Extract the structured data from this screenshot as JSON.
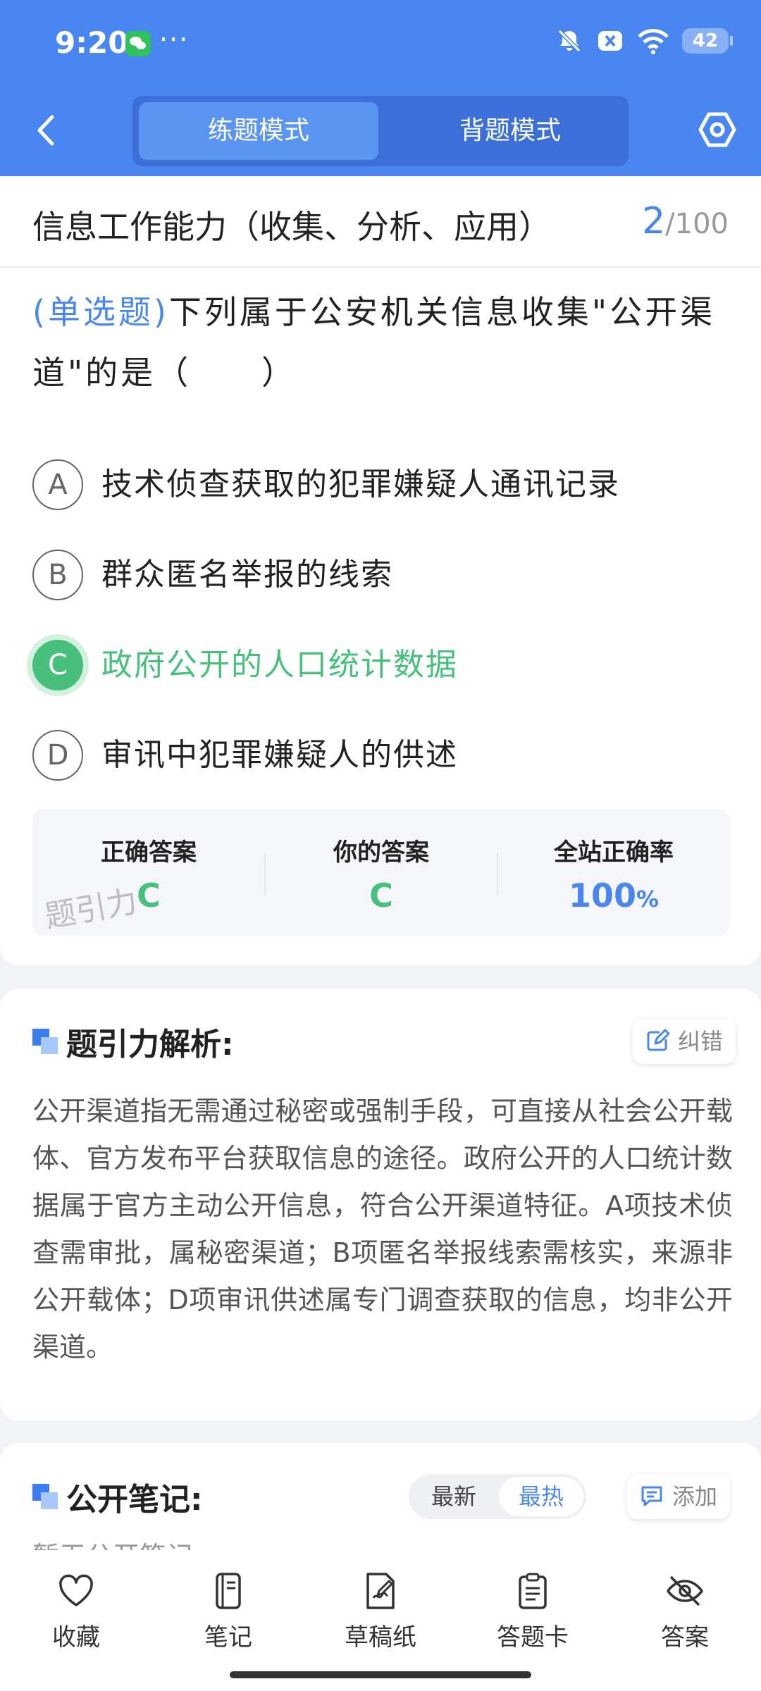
{
  "status_bar": {
    "time": "9:20",
    "dots": "···",
    "battery": "42"
  },
  "header": {
    "mode_tabs": [
      "练题模式",
      "背题模式"
    ],
    "active_mode": "练题模式"
  },
  "question": {
    "section": "信息工作能力（收集、分析、应用）",
    "current": "2",
    "total": "/100",
    "type_label": "(单选题)",
    "text": "下列属于公安机关信息收集\"公开渠道\"的是（　　）",
    "options": [
      {
        "letter": "A",
        "text": "技术侦查获取的犯罪嫌疑人通讯记录"
      },
      {
        "letter": "B",
        "text": "群众匿名举报的线索"
      },
      {
        "letter": "C",
        "text": "政府公开的人口统计数据"
      },
      {
        "letter": "D",
        "text": "审讯中犯罪嫌疑人的供述"
      }
    ],
    "correct_letter": "C"
  },
  "stats": {
    "correct_label": "正确答案",
    "correct_value": "C",
    "yours_label": "你的答案",
    "yours_value": "C",
    "rate_label": "全站正确率",
    "rate_value": "100",
    "rate_unit": "%",
    "watermark": "题引力"
  },
  "analysis": {
    "title": "题引力解析:",
    "report_label": "纠错",
    "text": "公开渠道指无需通过秘密或强制手段，可直接从社会公开载体、官方发布平台获取信息的途径。政府公开的人口统计数据属于官方主动公开信息，符合公开渠道特征。A项技术侦查需审批，属秘密渠道；B项匿名举报线索需核实，来源非公开载体；D项审讯供述属专门调查获取的信息，均非公开渠道。"
  },
  "notes": {
    "title": "公开笔记:",
    "sort_newest": "最新",
    "sort_hottest": "最热",
    "add_label": "添加",
    "peek_text": "暂无公开笔记"
  },
  "bottom_nav": [
    {
      "label": "收藏",
      "icon": "heart-icon"
    },
    {
      "label": "笔记",
      "icon": "notebook-icon"
    },
    {
      "label": "草稿纸",
      "icon": "draft-icon"
    },
    {
      "label": "答题卡",
      "icon": "clipboard-icon"
    },
    {
      "label": "答案",
      "icon": "eye-off-icon"
    }
  ],
  "colors": {
    "primary": "#4a86f0",
    "correct": "#47c07b",
    "text": "#222222"
  }
}
